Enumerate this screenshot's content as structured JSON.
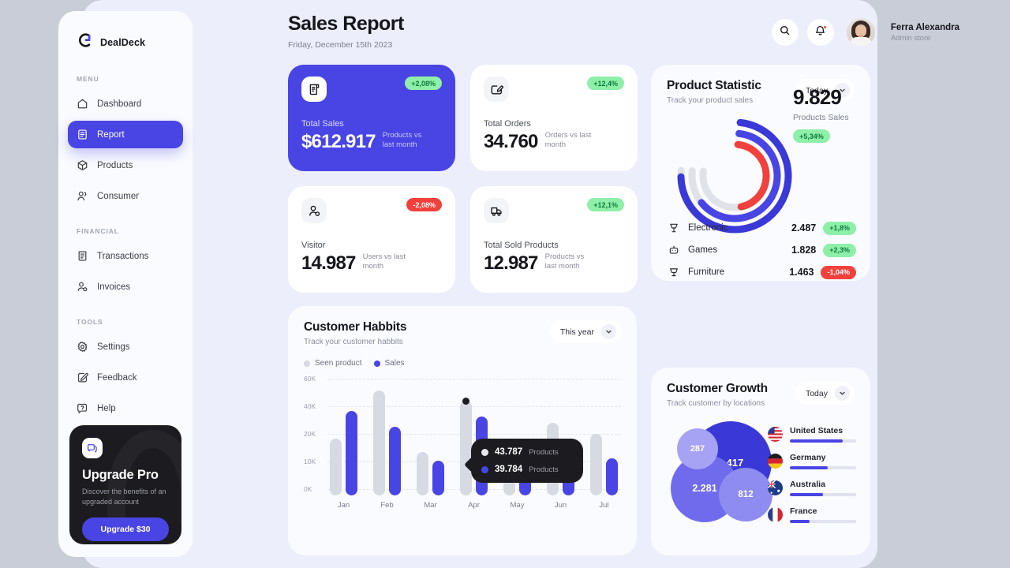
{
  "brand": {
    "name": "DealDeck",
    "logo_icon": "dealdeck-logo-icon"
  },
  "sidebar": {
    "sections": [
      {
        "label": "MENU",
        "items": [
          {
            "label": "Dashboard",
            "icon": "home-icon",
            "active": false
          },
          {
            "label": "Report",
            "icon": "report-icon",
            "active": true
          },
          {
            "label": "Products",
            "icon": "box-icon",
            "active": false
          },
          {
            "label": "Consumer",
            "icon": "users-icon",
            "active": false
          }
        ]
      },
      {
        "label": "FINANCIAL",
        "items": [
          {
            "label": "Transactions",
            "icon": "receipt-icon",
            "active": false
          },
          {
            "label": "Invoices",
            "icon": "user-check-icon",
            "active": false
          }
        ]
      },
      {
        "label": "TOOLS",
        "items": [
          {
            "label": "Settings",
            "icon": "gear-icon",
            "active": false
          },
          {
            "label": "Feedback",
            "icon": "edit-icon",
            "active": false
          },
          {
            "label": "Help",
            "icon": "help-icon",
            "active": false
          }
        ]
      }
    ],
    "upgrade": {
      "badge_icon": "chat-icon",
      "title": "Upgrade Pro",
      "subtitle": "Discover the benefits of an upgraded account",
      "button_label": "Upgrade $30"
    }
  },
  "header": {
    "title": "Sales Report",
    "date": "Friday, December 15th 2023",
    "search_icon": "search-icon",
    "bell_icon": "bell-icon",
    "user": {
      "name": "Ferra Alexandra",
      "role": "Admin store",
      "avatar": "avatar"
    }
  },
  "stats": [
    {
      "icon": "receipt-icon",
      "label": "Total Sales",
      "value": "$612.917",
      "note": "Products vs last month",
      "badge": "+2,08%",
      "trend": "up",
      "primary": true
    },
    {
      "icon": "order-edit-icon",
      "label": "Total Orders",
      "value": "34.760",
      "note": "Orders vs last month",
      "badge": "+12,4%",
      "trend": "up",
      "primary": false
    },
    {
      "icon": "visitor-icon",
      "label": "Visitor",
      "value": "14.987",
      "note": "Users vs last month",
      "badge": "-2,08%",
      "trend": "down",
      "primary": false
    },
    {
      "icon": "truck-icon",
      "label": "Total Sold Products",
      "value": "12.987",
      "note": "Products vs last month",
      "badge": "+12,1%",
      "trend": "up",
      "primary": false
    }
  ],
  "habbits": {
    "title": "Customer Habbits",
    "subtitle": "Track your customer habbits",
    "range": "This year",
    "legend": [
      {
        "label": "Seen product",
        "color": "#d7d9e3"
      },
      {
        "label": "Sales",
        "color": "#4945e4"
      }
    ],
    "tooltip": [
      {
        "value": "43.787",
        "unit": "Products",
        "color": "#e8e9f0"
      },
      {
        "value": "39.784",
        "unit": "Products",
        "color": "#4945e4"
      }
    ]
  },
  "product_statistic": {
    "title": "Product Statistic",
    "subtitle": "Track your product sales",
    "range": "Today",
    "total": "9.829",
    "total_caption": "Products Sales",
    "total_badge": "+5,34%",
    "items": [
      {
        "icon": "electronic-icon",
        "name": "Electronic",
        "value": "2.487",
        "badge": "+1,8%",
        "trend": "up"
      },
      {
        "icon": "games-icon",
        "name": "Games",
        "value": "1.828",
        "badge": "+2,3%",
        "trend": "up"
      },
      {
        "icon": "furniture-icon",
        "name": "Furniture",
        "value": "1.463",
        "badge": "-1,04%",
        "trend": "down"
      }
    ]
  },
  "customer_growth": {
    "title": "Customer Growth",
    "subtitle": "Track customer by locations",
    "range": "Today",
    "countries": [
      {
        "name": "United States",
        "flag": "flag-us",
        "progress": 80
      },
      {
        "name": "Germany",
        "flag": "flag-de",
        "progress": 57
      },
      {
        "name": "Australia",
        "flag": "flag-au",
        "progress": 50
      },
      {
        "name": "France",
        "flag": "flag-fr",
        "progress": 30
      }
    ]
  },
  "colors": {
    "accent": "#4945e4",
    "accent_light": "#7b77ee",
    "accent_pale": "#a6a3f4",
    "positive": "#8ef0a8",
    "positive_text": "#0f7a3d",
    "negative": "#f0413c",
    "grey_bar": "#d7d9e3",
    "window_bg": "#eceefb",
    "card_bg": "#fafbff",
    "dark": "#1c1c20"
  },
  "chart_data": [
    {
      "type": "bar",
      "title": "Customer Habbits",
      "categories": [
        "Jan",
        "Feb",
        "Mar",
        "Apr",
        "May",
        "Jun",
        "Jul"
      ],
      "series": [
        {
          "name": "Seen product",
          "color": "#d7d9e3",
          "values": [
            21000,
            57000,
            14000,
            49000,
            21000,
            32000,
            24000
          ]
        },
        {
          "name": "Sales",
          "color": "#4945e4",
          "values": [
            40000,
            29000,
            11000,
            37000,
            10000,
            21000,
            12000
          ]
        }
      ],
      "ylabel": "",
      "xlabel": "",
      "yticks": [
        "0K",
        "10K",
        "20K",
        "40K",
        "60K"
      ],
      "ylim": [
        0,
        60000
      ],
      "grid": true,
      "legend": "top-left",
      "highlight": {
        "category": "Apr",
        "series": "Seen product",
        "values": [
          "43.787",
          "39.784"
        ],
        "unit": "Products"
      }
    },
    {
      "type": "pie",
      "title": "Product Statistic",
      "subtitle": "Track your product sales",
      "center_value": "9.829",
      "center_label": "Products Sales",
      "arcs": [
        {
          "name": "Electronic",
          "value": 2487,
          "percent": 75,
          "color": "#3b38d8"
        },
        {
          "name": "Games",
          "value": 1828,
          "percent": 62,
          "color": "#4945e4"
        },
        {
          "name": "Furniture",
          "value": 1463,
          "percent": 45,
          "color": "#f0413c"
        }
      ]
    },
    {
      "type": "scatter",
      "title": "Customer Growth",
      "subtitle": "Track customer by locations",
      "bubbles": [
        {
          "label": "2.417",
          "value": 2417,
          "color": "#3b38d8",
          "r": 52
        },
        {
          "label": "2.281",
          "value": 2281,
          "color": "#6f6bec",
          "r": 43
        },
        {
          "label": "812",
          "value": 812,
          "color": "#8e8bf1",
          "r": 34
        },
        {
          "label": "287",
          "value": 287,
          "color": "#a6a3f4",
          "r": 26
        }
      ],
      "legend": [
        {
          "name": "United States",
          "progress": 80
        },
        {
          "name": "Germany",
          "progress": 57
        },
        {
          "name": "Australia",
          "progress": 50
        },
        {
          "name": "France",
          "progress": 30
        }
      ]
    }
  ]
}
